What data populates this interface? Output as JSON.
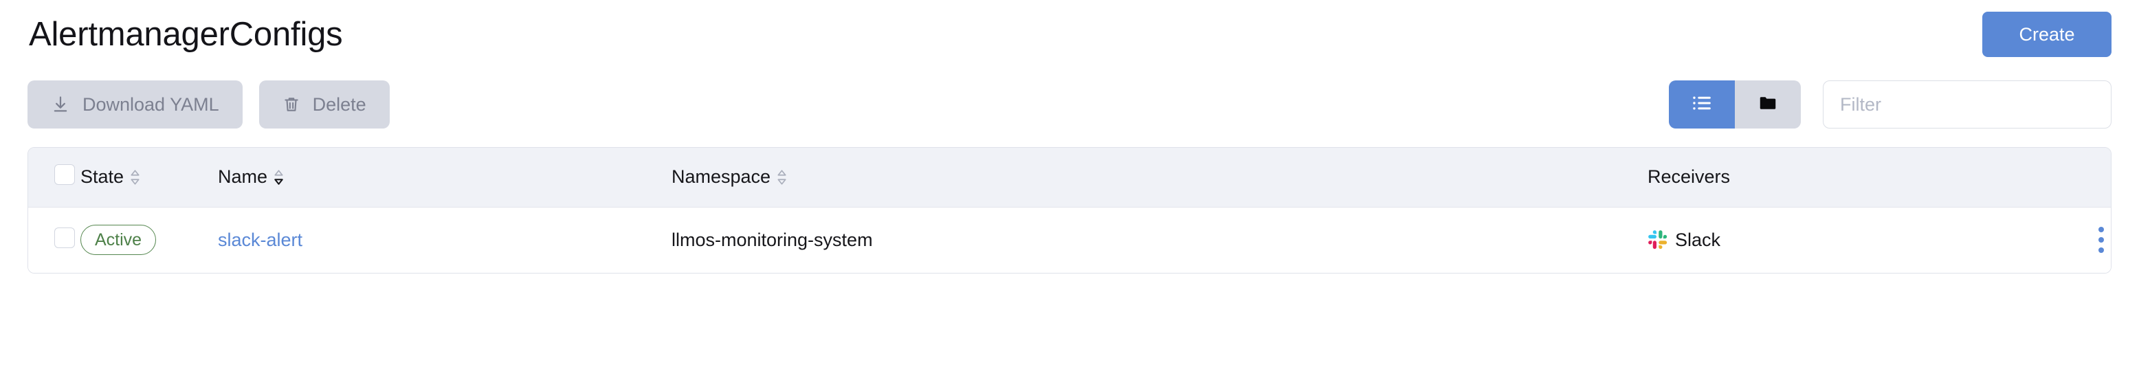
{
  "header": {
    "title": "AlertmanagerConfigs",
    "create_label": "Create"
  },
  "toolbar": {
    "download_yaml_label": "Download YAML",
    "delete_label": "Delete",
    "filter_placeholder": "Filter",
    "filter_value": "",
    "view_toggle": {
      "active": "list",
      "options": [
        {
          "id": "list",
          "icon": "list-view-icon"
        },
        {
          "id": "folder",
          "icon": "folder-view-icon"
        }
      ]
    }
  },
  "table": {
    "columns": [
      {
        "key": "state",
        "label": "State",
        "sortable": true,
        "sorted": "none"
      },
      {
        "key": "name",
        "label": "Name",
        "sortable": true,
        "sorted": "asc"
      },
      {
        "key": "namespace",
        "label": "Namespace",
        "sortable": true,
        "sorted": "none"
      },
      {
        "key": "receivers",
        "label": "Receivers",
        "sortable": false,
        "sorted": "none"
      }
    ],
    "rows": [
      {
        "selected": false,
        "state": "Active",
        "name": "slack-alert",
        "namespace": "llmos-monitoring-system",
        "receiver": "Slack"
      }
    ]
  },
  "colors": {
    "accent_blue": "#5a88d6",
    "badge_green": "#4d8048",
    "header_band": "#f0f2f7",
    "button_grey": "#d6d9e2",
    "border": "#dfe2ea"
  }
}
